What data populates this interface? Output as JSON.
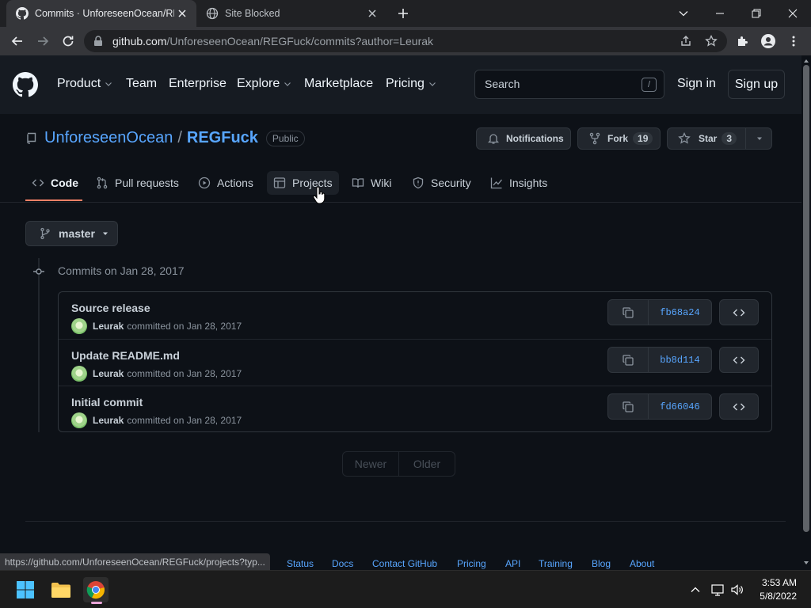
{
  "browser": {
    "tabs": [
      {
        "title": "Commits · UnforeseenOcean/REGFuck",
        "icon": "github-icon",
        "active": true
      },
      {
        "title": "Site Blocked",
        "icon": "globe-icon",
        "active": false
      }
    ],
    "url_host": "github.com",
    "url_path": "/UnforeseenOcean/REGFuck/commits?author=Leurak",
    "status_url": "https://github.com/UnforeseenOcean/REGFuck/projects?typ..."
  },
  "gh_header": {
    "nav": [
      {
        "label": "Product",
        "has_caret": true
      },
      {
        "label": "Team",
        "has_caret": false
      },
      {
        "label": "Enterprise",
        "has_caret": false
      },
      {
        "label": "Explore",
        "has_caret": true
      },
      {
        "label": "Marketplace",
        "has_caret": false
      },
      {
        "label": "Pricing",
        "has_caret": true
      }
    ],
    "search_placeholder": "Search",
    "search_hotkey": "/",
    "sign_in": "Sign in",
    "sign_up": "Sign up"
  },
  "repo": {
    "owner": "UnforeseenOcean",
    "separator": "/",
    "name": "REGFuck",
    "visibility": "Public",
    "notifications_label": "Notifications",
    "fork_label": "Fork",
    "fork_count": "19",
    "star_label": "Star",
    "star_count": "3",
    "tabs": [
      {
        "label": "Code",
        "icon": "code-icon",
        "selected": true
      },
      {
        "label": "Pull requests",
        "icon": "pull-request-icon",
        "selected": false
      },
      {
        "label": "Actions",
        "icon": "play-icon",
        "selected": false
      },
      {
        "label": "Projects",
        "icon": "table-icon",
        "selected": false,
        "hovered": true
      },
      {
        "label": "Wiki",
        "icon": "book-icon",
        "selected": false
      },
      {
        "label": "Security",
        "icon": "shield-icon",
        "selected": false
      },
      {
        "label": "Insights",
        "icon": "graph-icon",
        "selected": false
      }
    ]
  },
  "branch": "master",
  "commits": {
    "date_heading": "Commits on Jan 28, 2017",
    "items": [
      {
        "message": "Source release",
        "author": "Leurak",
        "meta": "committed on Jan 28, 2017",
        "sha": "fb68a24"
      },
      {
        "message": "Update README.md",
        "author": "Leurak",
        "meta": "committed on Jan 28, 2017",
        "sha": "bb8d114"
      },
      {
        "message": "Initial commit",
        "author": "Leurak",
        "meta": "committed on Jan 28, 2017",
        "sha": "fd66046"
      }
    ]
  },
  "pager": {
    "newer": "Newer",
    "older": "Older"
  },
  "footer": [
    "Status",
    "Docs",
    "Contact GitHub",
    "Pricing",
    "API",
    "Training",
    "Blog",
    "About"
  ],
  "taskbar": {
    "time": "3:53 AM",
    "date": "5/8/2022"
  }
}
